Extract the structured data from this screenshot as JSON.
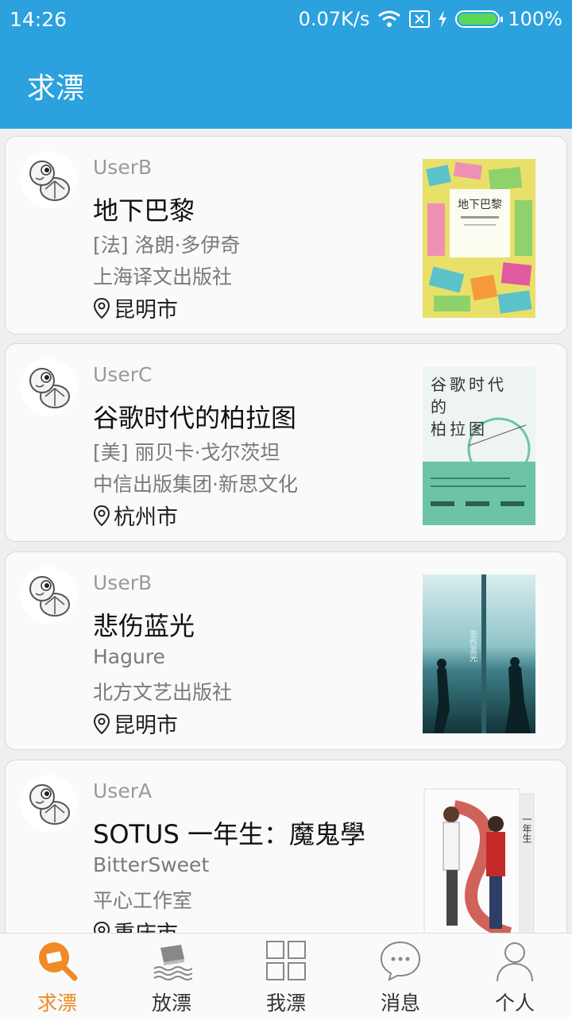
{
  "status": {
    "time": "14:26",
    "speed": "0.07K/s",
    "battery": "100%"
  },
  "header": {
    "title": "求漂"
  },
  "items": [
    {
      "user": "UserB",
      "title": "地下巴黎",
      "author": "[法] 洛朗·多伊奇",
      "publisher": "上海译文出版社",
      "location": "昆明市",
      "cover_text": "地下巴黎"
    },
    {
      "user": "UserC",
      "title": "谷歌时代的柏拉图",
      "author": "[美] 丽贝卡·戈尔茨坦",
      "publisher": "中信出版集团·新思文化",
      "location": "杭州市",
      "cover_text": "谷歌时代的柏拉图"
    },
    {
      "user": "UserB",
      "title": "悲伤蓝光",
      "author": "Hagure",
      "publisher": "北方文艺出版社",
      "location": "昆明市",
      "cover_text": "悲伤蓝光"
    },
    {
      "user": "UserA",
      "title": "SOTUS  一年生：魔鬼學",
      "author": "BitterSweet",
      "publisher": "平心工作室",
      "location": "重庆市",
      "cover_text": "一年生"
    }
  ],
  "tabs": [
    {
      "label": "求漂",
      "icon": "search-book-icon",
      "active": true
    },
    {
      "label": "放漂",
      "icon": "book-drift-icon",
      "active": false
    },
    {
      "label": "我漂",
      "icon": "grid-icon",
      "active": false
    },
    {
      "label": "消息",
      "icon": "chat-bubble-icon",
      "active": false
    },
    {
      "label": "个人",
      "icon": "person-icon",
      "active": false
    }
  ],
  "colors": {
    "primary": "#2ba1dd",
    "accent": "#f08a24"
  }
}
